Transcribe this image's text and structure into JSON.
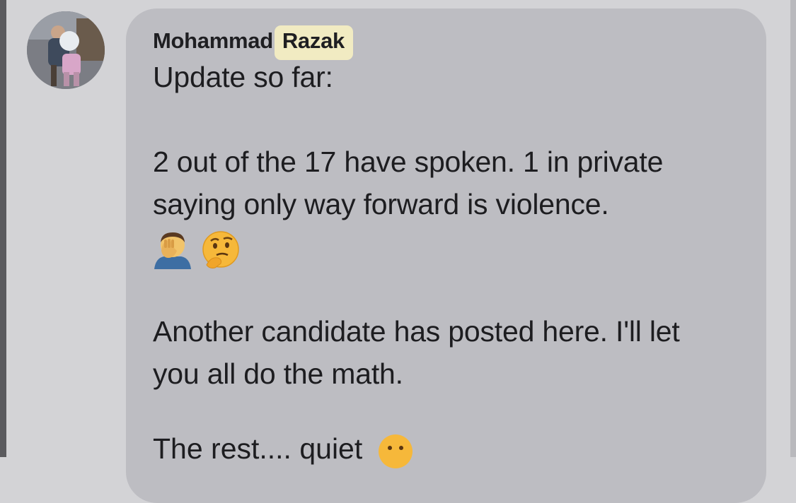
{
  "comment": {
    "author": {
      "first_name": "Mohammad",
      "last_name": "Razak"
    },
    "lines": [
      "Update so far:",
      "2 out of the 17 have spoken. 1 in private",
      "saying only way forward is violence.",
      "Another candidate has posted here. I'll let",
      "you all do the math.",
      "The rest.... quiet"
    ],
    "emojis": [
      "facepalm-icon",
      "thinking-face-icon",
      "zipper-mouth-icon"
    ]
  },
  "colors": {
    "page_background": "#d3d3d6",
    "bubble_background": "#bdbdc2",
    "name_highlight": "#f1ebc2",
    "text": "#1d1d20"
  }
}
